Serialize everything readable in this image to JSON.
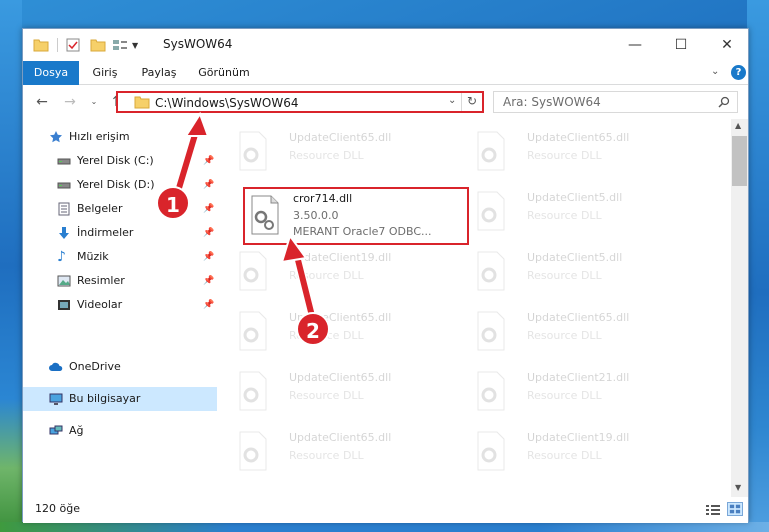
{
  "window": {
    "title": "SysWOW64",
    "minimize": "—",
    "maximize": "☐",
    "close": "✕"
  },
  "ribbon": {
    "tabs": [
      "Dosya",
      "Giriş",
      "Paylaş",
      "Görünüm"
    ]
  },
  "nav": {
    "address": "C:\\Windows\\SysWOW64",
    "search_placeholder": "Ara: SysWOW64"
  },
  "sidebar": {
    "items": [
      {
        "label": "Hızlı erişim",
        "icon": "star-icon"
      },
      {
        "label": "Yerel Disk (C:)",
        "icon": "drive-icon"
      },
      {
        "label": "Yerel Disk (D:)",
        "icon": "drive-icon"
      },
      {
        "label": "Belgeler",
        "icon": "documents-icon"
      },
      {
        "label": "İndirmeler",
        "icon": "download-icon"
      },
      {
        "label": "Müzik",
        "icon": "music-icon"
      },
      {
        "label": "Resimler",
        "icon": "pictures-icon"
      },
      {
        "label": "Videolar",
        "icon": "video-icon"
      },
      {
        "label": "OneDrive",
        "icon": "cloud-icon"
      },
      {
        "label": "Bu bilgisayar",
        "icon": "computer-icon"
      },
      {
        "label": "Ağ",
        "icon": "network-icon"
      }
    ]
  },
  "files": {
    "highlighted": {
      "name": "cror714.dll",
      "version": "3.50.0.0",
      "description": "MERANT Oracle7 ODBC..."
    },
    "left_column": [
      {
        "name": "UpdateClient65.dll",
        "sub": "Resource DLL"
      },
      {
        "name": "UpdateClient19.dll",
        "sub": "Resource DLL"
      },
      {
        "name": "UpdateClient65.dll",
        "sub": "Resource DLL"
      },
      {
        "name": "UpdateClient65.dll",
        "sub": "Resource DLL"
      },
      {
        "name": "UpdateClient65.dll",
        "sub": "Resource DLL"
      }
    ],
    "right_column": [
      {
        "name": "UpdateClient65.dll",
        "sub": "Resource DLL"
      },
      {
        "name": "UpdateClient5.dll",
        "sub": "Resource DLL"
      },
      {
        "name": "UpdateClient5.dll",
        "sub": "Resource DLL"
      },
      {
        "name": "UpdateClient65.dll",
        "sub": "Resource DLL"
      },
      {
        "name": "UpdateClient21.dll",
        "sub": "Resource DLL"
      },
      {
        "name": "UpdateClient19.dll",
        "sub": "Resource DLL"
      }
    ]
  },
  "status": {
    "count": "120 öğe"
  },
  "callouts": [
    "1",
    "2"
  ],
  "colors": {
    "accent": "#1979ca",
    "highlight_red": "#d9242b"
  }
}
